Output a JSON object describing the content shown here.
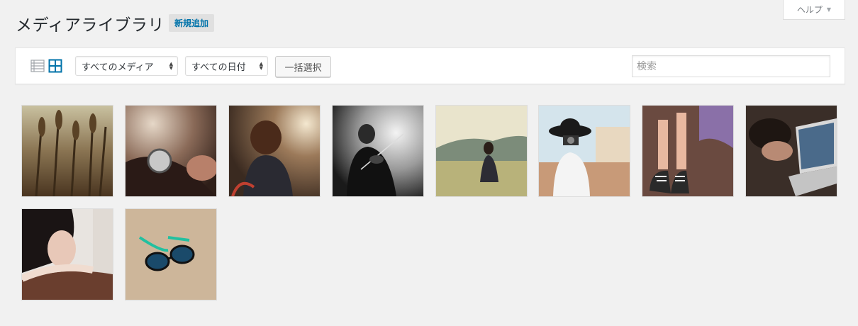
{
  "page": {
    "title": "メディアライブラリ",
    "add_new_label": "新規追加",
    "help_label": "ヘルプ"
  },
  "toolbar": {
    "view_list_icon": "list-view-icon",
    "view_grid_icon": "grid-view-icon",
    "media_filter": {
      "selected": "すべてのメディア"
    },
    "date_filter": {
      "selected": "すべての日付"
    },
    "bulk_select_label": "一括選択",
    "search_placeholder": "検索"
  },
  "colors": {
    "accent": "#0073aa",
    "background": "#f1f1f1",
    "panel": "#ffffff"
  },
  "media_items": [
    {
      "subject": "wheat-field-photo"
    },
    {
      "subject": "wristwatch-hand-photo"
    },
    {
      "subject": "woman-backlit-photo"
    },
    {
      "subject": "violinist-bw-photo"
    },
    {
      "subject": "woman-sitting-field-photo"
    },
    {
      "subject": "woman-camera-hat-photo"
    },
    {
      "subject": "sneakers-legs-photo"
    },
    {
      "subject": "woman-laptop-photo"
    },
    {
      "subject": "woman-portrait-photo"
    },
    {
      "subject": "sunglasses-sand-photo"
    }
  ]
}
